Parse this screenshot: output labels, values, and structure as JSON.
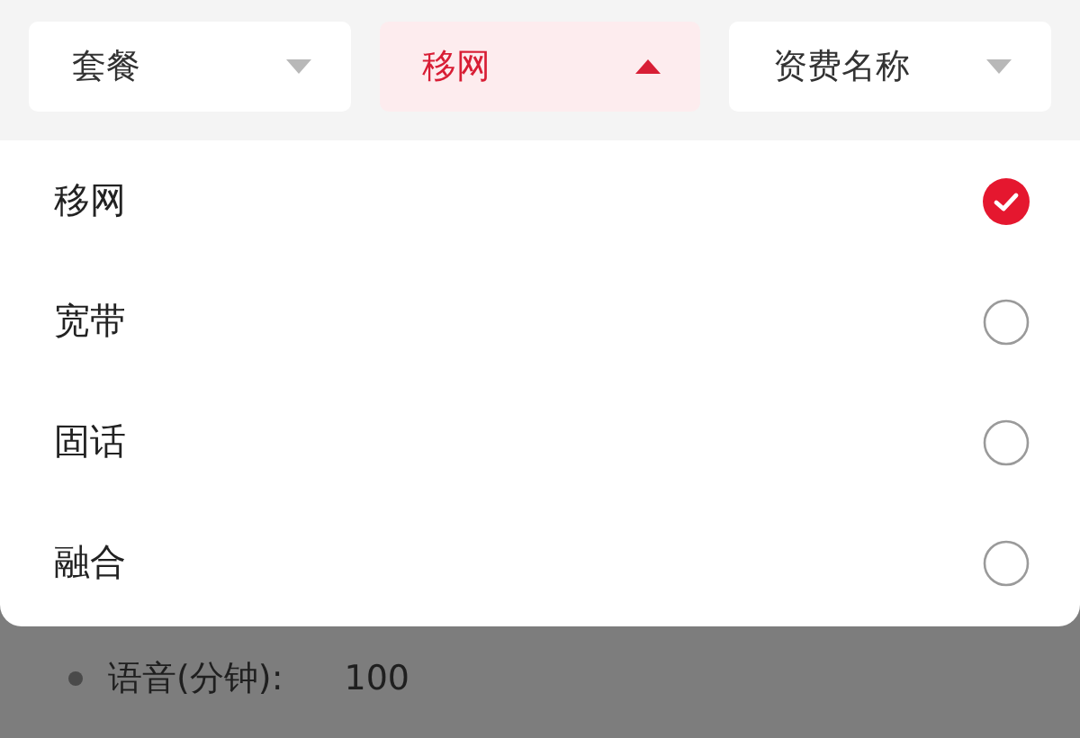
{
  "filters": [
    {
      "label": "套餐",
      "selected": false,
      "expanded": false
    },
    {
      "label": "移网",
      "selected": true,
      "expanded": true
    },
    {
      "label": "资费名称",
      "selected": false,
      "expanded": false
    }
  ],
  "options": [
    {
      "label": "移网",
      "selected": true
    },
    {
      "label": "宽带",
      "selected": false
    },
    {
      "label": "固话",
      "selected": false
    },
    {
      "label": "融合",
      "selected": false
    }
  ],
  "background_item": {
    "label": "语音(分钟):",
    "value": "100"
  }
}
